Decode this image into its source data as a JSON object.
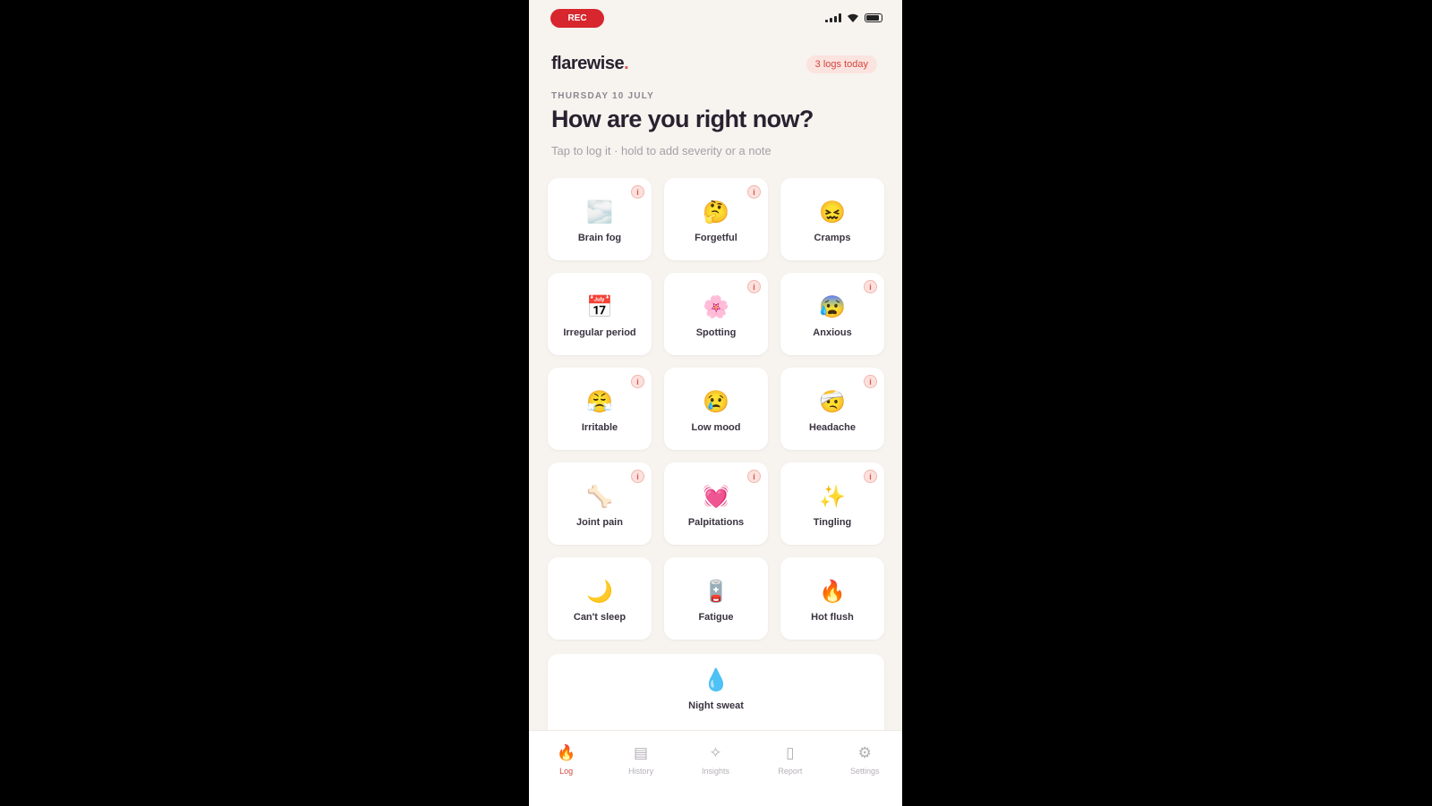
{
  "status_bar": {
    "recording_label": "REC",
    "icons": [
      "signal-icon",
      "wifi-icon",
      "battery-icon"
    ]
  },
  "header": {
    "brand": "flarewise",
    "brand_dot": ".",
    "logs_badge": "3 logs today"
  },
  "main": {
    "date_label": "THURSDAY 10 JULY",
    "headline": "How are you right now?",
    "subtext": "Tap to log it · hold to add severity or a note"
  },
  "symptoms": [
    {
      "label": "Brain fog",
      "emoji": "🌫️",
      "info": "i"
    },
    {
      "label": "Forgetful",
      "emoji": "🤔",
      "info": "i"
    },
    {
      "label": "Cramps",
      "emoji": "😖",
      "info": ""
    },
    {
      "label": "Irregular period",
      "emoji": "📅",
      "info": ""
    },
    {
      "label": "Spotting",
      "emoji": "🌸",
      "info": "i"
    },
    {
      "label": "Anxious",
      "emoji": "😰",
      "info": "i"
    },
    {
      "label": "Irritable",
      "emoji": "😤",
      "info": "i"
    },
    {
      "label": "Low mood",
      "emoji": "😢",
      "info": ""
    },
    {
      "label": "Headache",
      "emoji": "🤕",
      "info": "i"
    },
    {
      "label": "Joint pain",
      "emoji": "🦴",
      "info": "i"
    },
    {
      "label": "Palpitations",
      "emoji": "💓",
      "info": "i"
    },
    {
      "label": "Tingling",
      "emoji": "✨",
      "info": "i"
    },
    {
      "label": "Can't sleep",
      "emoji": "🌙",
      "info": ""
    },
    {
      "label": "Fatigue",
      "emoji": "🪫",
      "info": ""
    },
    {
      "label": "Hot flush",
      "emoji": "🔥",
      "info": ""
    }
  ],
  "wide_symptom": {
    "label": "Night sweat",
    "emoji": "💧"
  },
  "tabs": [
    {
      "label": "Log",
      "icon": "🔥",
      "active": true
    },
    {
      "label": "History",
      "icon": "▤",
      "active": false
    },
    {
      "label": "Insights",
      "icon": "✧",
      "active": false
    },
    {
      "label": "Report",
      "icon": "▯",
      "active": false
    },
    {
      "label": "Settings",
      "icon": "⚙",
      "active": false
    }
  ],
  "colors": {
    "accent": "#d8463f",
    "background": "#f7f3ef",
    "text_primary": "#2a2130"
  }
}
